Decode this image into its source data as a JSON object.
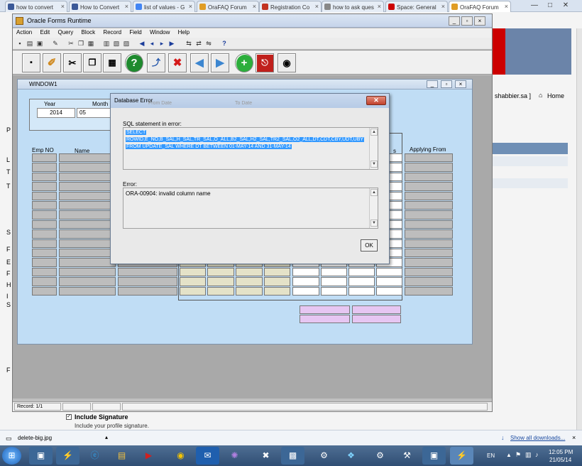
{
  "browser": {
    "tabs": [
      {
        "title": "how to convert",
        "fav_color": "#3b5998"
      },
      {
        "title": "How to Convert",
        "fav_color": "#3b5998"
      },
      {
        "title": "list of values - G",
        "fav_color": "#4285f4"
      },
      {
        "title": "OraFAQ Forum",
        "fav_color": "#e09d25"
      },
      {
        "title": "Registration Co",
        "fav_color": "#c23321"
      },
      {
        "title": "how to ask ques",
        "fav_color": "#888888"
      },
      {
        "title": "Space: General",
        "fav_color": "#cc0000"
      },
      {
        "title": "OraFAQ Forum",
        "fav_color": "#e09d25"
      }
    ],
    "close_glyph": "×",
    "win_min": "—",
    "win_max": "□",
    "win_close": "✕"
  },
  "forms": {
    "window_title": "Oracle Forms Runtime",
    "menu": [
      "Action",
      "Edit",
      "Query",
      "Block",
      "Record",
      "Field",
      "Window",
      "Help"
    ],
    "help_glyph": "?",
    "status_record": "Record: 1/1"
  },
  "window1": {
    "title": "WINDOW1",
    "year_label": "Year",
    "month_label": "Month",
    "year_value": "2014",
    "month_value": "05",
    "col_emp_no": "Emp NO",
    "col_name": "Name",
    "col_applying_from": "Applying From",
    "partial_s": "s",
    "hidden_from_date": "From Date",
    "hidden_to_date": "To Date"
  },
  "error_dialog": {
    "title": "Database Error",
    "close_glyph": "✕",
    "sql_label": "SQL statement in error:",
    "sql_line1": "SELECT",
    "sql_line2": "ROWID,E_NO,B_SAL,H_SAL,TR_SAL,O_ALL,B2_SAL,H2_SAL,TR2_SAL,O2_ALL,DT,CDT,CBY,UDT,UBY",
    "sql_line3": "FROM UPDATE_SAL WHERE DT BETWEEN 01-MAY-14 AND 31-MAY-14",
    "error_label": "Error:",
    "error_text": "ORA-00904: invalid column name",
    "ok_label": "OK"
  },
  "webpage": {
    "user_text": "shabbier.sa ]",
    "home_label": "Home",
    "include_signature": "Include Signature",
    "include_signature_desc": "Include your profile signature.",
    "left_letters": [
      "P",
      "L",
      "T",
      "T",
      "S",
      "F",
      "E",
      "F",
      "H",
      "I",
      "S",
      "F"
    ]
  },
  "download_bar": {
    "file_name": "delete-big.jpg",
    "show_all": "Show all downloads..."
  },
  "taskbar": {
    "lang": "EN",
    "time": "12:05 PM",
    "date": "21/05/14"
  }
}
